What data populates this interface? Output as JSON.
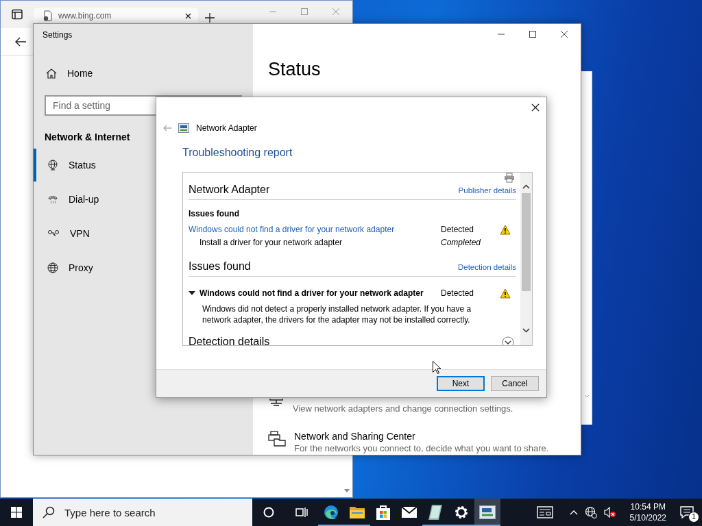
{
  "browser": {
    "tab": {
      "title": "www.bing.com"
    }
  },
  "settings": {
    "window_title": "Settings",
    "home": "Home",
    "search": {
      "placeholder": "Find a setting"
    },
    "section": "Network & Internet",
    "nav": [
      {
        "label": "Status",
        "kind": "status",
        "selected": true
      },
      {
        "label": "Dial-up",
        "kind": "dialup",
        "selected": false
      },
      {
        "label": "VPN",
        "kind": "vpn",
        "selected": false
      },
      {
        "label": "Proxy",
        "kind": "proxy",
        "selected": false
      }
    ],
    "page_title": "Status",
    "options": [
      {
        "kind": "adapter",
        "description": "View network adapters and change connection settings."
      },
      {
        "kind": "sharing",
        "title": "Network and Sharing Center",
        "description": "For the networks you connect to, decide what you want to share."
      }
    ]
  },
  "dialog": {
    "title": "Network Adapter",
    "heading": "Troubleshooting report",
    "report": {
      "package": {
        "title": "Network Adapter",
        "link": "Publisher details",
        "issues_label": "Issues found",
        "issues": [
          {
            "name": "Windows could not find a driver for your network adapter",
            "status": "Detected",
            "fix": "Install a driver for your network adapter",
            "fix_status": "Completed"
          }
        ]
      },
      "issues_section": {
        "title": "Issues found",
        "link": "Detection details",
        "items": [
          {
            "name": "Windows could not find a driver for your network adapter",
            "status": "Detected",
            "expanded": true,
            "description": "Windows did not detect a properly installed network adapter. If you have a network adapter, the drivers for the adapter may not be installed correctly."
          }
        ]
      },
      "next_section": "Detection details"
    },
    "buttons": [
      {
        "label": "Next",
        "default": true
      },
      {
        "label": "Cancel",
        "default": false
      }
    ]
  },
  "taskbar": {
    "search_placeholder": "Type here to search",
    "apps": [
      {
        "kind": "edge",
        "running": true,
        "selected": false
      },
      {
        "kind": "explorer",
        "running": true,
        "selected": false
      },
      {
        "kind": "store",
        "running": false,
        "selected": false
      },
      {
        "kind": "mail",
        "running": false,
        "selected": false
      },
      {
        "kind": "notes",
        "running": true,
        "selected": false
      },
      {
        "kind": "settings",
        "running": true,
        "selected": false
      },
      {
        "kind": "troubleshooter",
        "running": true,
        "selected": true
      }
    ],
    "time": "10:54 PM",
    "date": "5/10/2022",
    "notification_count": "1"
  }
}
